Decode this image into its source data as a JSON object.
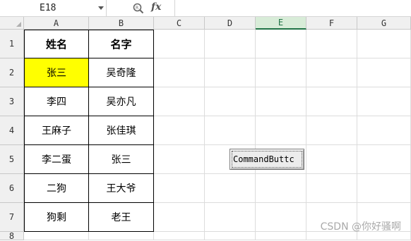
{
  "formula_bar": {
    "name_box": "E18",
    "fx_label": "fx"
  },
  "columns": [
    "A",
    "B",
    "C",
    "D",
    "E",
    "F",
    "G"
  ],
  "selected_column": "E",
  "rows": [
    "1",
    "2",
    "3",
    "4",
    "5",
    "6",
    "7",
    "8"
  ],
  "table": {
    "headers": [
      "姓名",
      "名字"
    ],
    "data": [
      [
        "张三",
        "吴奇隆"
      ],
      [
        "李四",
        "吴亦凡"
      ],
      [
        "王麻子",
        "张佳琪"
      ],
      [
        "李二蛋",
        "张三"
      ],
      [
        "二狗",
        "王大爷"
      ],
      [
        "狗剩",
        "老王"
      ]
    ]
  },
  "highlight_color": "#FFFF00",
  "command_button": {
    "label": "CommandButtc"
  },
  "watermark": "CSDN @你好骚啊"
}
